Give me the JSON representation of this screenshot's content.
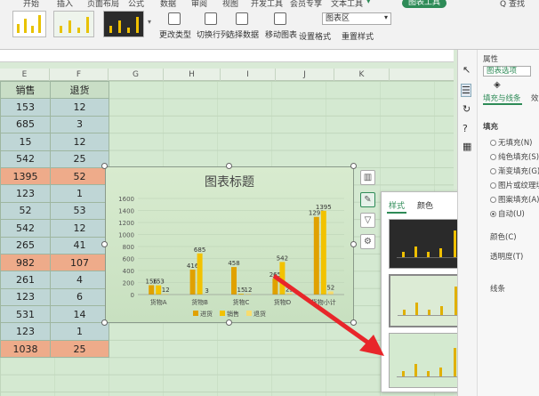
{
  "ribbon": {
    "tabs": [
      "开始",
      "插入",
      "页面布局",
      "公式",
      "数据",
      "审阅",
      "视图",
      "开发工具",
      "会员专享",
      "文本工具"
    ],
    "chart_tools_tab": "图表工具",
    "right_label": "Q 查找",
    "buttons": {
      "change_type": "更改类型",
      "switch_row_col": "切换行列",
      "select_data": "选择数据",
      "move_chart": "移动图表",
      "set_format": "设置格式",
      "reset_style": "重置样式"
    },
    "chart_area_select": "图表区"
  },
  "columns": [
    "E",
    "F",
    "G",
    "H",
    "I",
    "J",
    "K"
  ],
  "table": {
    "headers": [
      "销售",
      "退货"
    ],
    "rows": [
      {
        "sales": "153",
        "returns": "12",
        "kind": "n"
      },
      {
        "sales": "685",
        "returns": "3",
        "kind": "n"
      },
      {
        "sales": "15",
        "returns": "12",
        "kind": "n"
      },
      {
        "sales": "542",
        "returns": "25",
        "kind": "n"
      },
      {
        "sales": "1395",
        "returns": "52",
        "kind": "o"
      },
      {
        "sales": "123",
        "returns": "1",
        "kind": "n"
      },
      {
        "sales": "52",
        "returns": "53",
        "kind": "n"
      },
      {
        "sales": "542",
        "returns": "12",
        "kind": "n"
      },
      {
        "sales": "265",
        "returns": "41",
        "kind": "n"
      },
      {
        "sales": "982",
        "returns": "107",
        "kind": "o"
      },
      {
        "sales": "261",
        "returns": "4",
        "kind": "n"
      },
      {
        "sales": "123",
        "returns": "6",
        "kind": "n"
      },
      {
        "sales": "531",
        "returns": "14",
        "kind": "n"
      },
      {
        "sales": "123",
        "returns": "1",
        "kind": "n"
      },
      {
        "sales": "1038",
        "returns": "25",
        "kind": "o"
      }
    ]
  },
  "chart_data": {
    "type": "bar",
    "title": "图表标题",
    "categories": [
      "货物A",
      "货物B",
      "货物C",
      "货物D",
      "货物小计"
    ],
    "series": [
      {
        "name": "进货",
        "values": [
          156,
          416,
          458,
          265,
          1293
        ]
      },
      {
        "name": "销售",
        "values": [
          153,
          685,
          15,
          542,
          1395
        ]
      },
      {
        "name": "退货",
        "values": [
          12,
          3,
          12,
          25,
          52
        ]
      }
    ],
    "data_labels": [
      "156",
      "153",
      "12",
      "416",
      "685",
      "3",
      "458",
      "15",
      "12",
      "265",
      "542",
      "25",
      "1293",
      "1395",
      "52"
    ],
    "ylim": [
      0,
      1600
    ],
    "yticks": [
      "1600",
      "1400",
      "1200",
      "1000",
      "800",
      "600",
      "400",
      "200",
      "0"
    ],
    "legend_position": "bottom",
    "colors": [
      "#e0a100",
      "#f2c200",
      "#f7dc6f"
    ]
  },
  "popup": {
    "tab_style": "样式",
    "tab_color": "颜色",
    "selected": "样式"
  },
  "panel": {
    "title": "属性",
    "chart_options": "图表选项",
    "fill_line": "填充与线条",
    "effects": "效",
    "fill_section": "填充",
    "fill_options": [
      {
        "label": "无填充(N)",
        "selected": false
      },
      {
        "label": "纯色填充(S)",
        "selected": false
      },
      {
        "label": "渐变填充(G)",
        "selected": false
      },
      {
        "label": "图片或纹理填",
        "selected": false
      },
      {
        "label": "图案填充(A)",
        "selected": false
      },
      {
        "label": "自动(U)",
        "selected": true
      }
    ],
    "color_label": "颜色(C)",
    "transparency_label": "透明度(T)",
    "line_section": "线条"
  }
}
